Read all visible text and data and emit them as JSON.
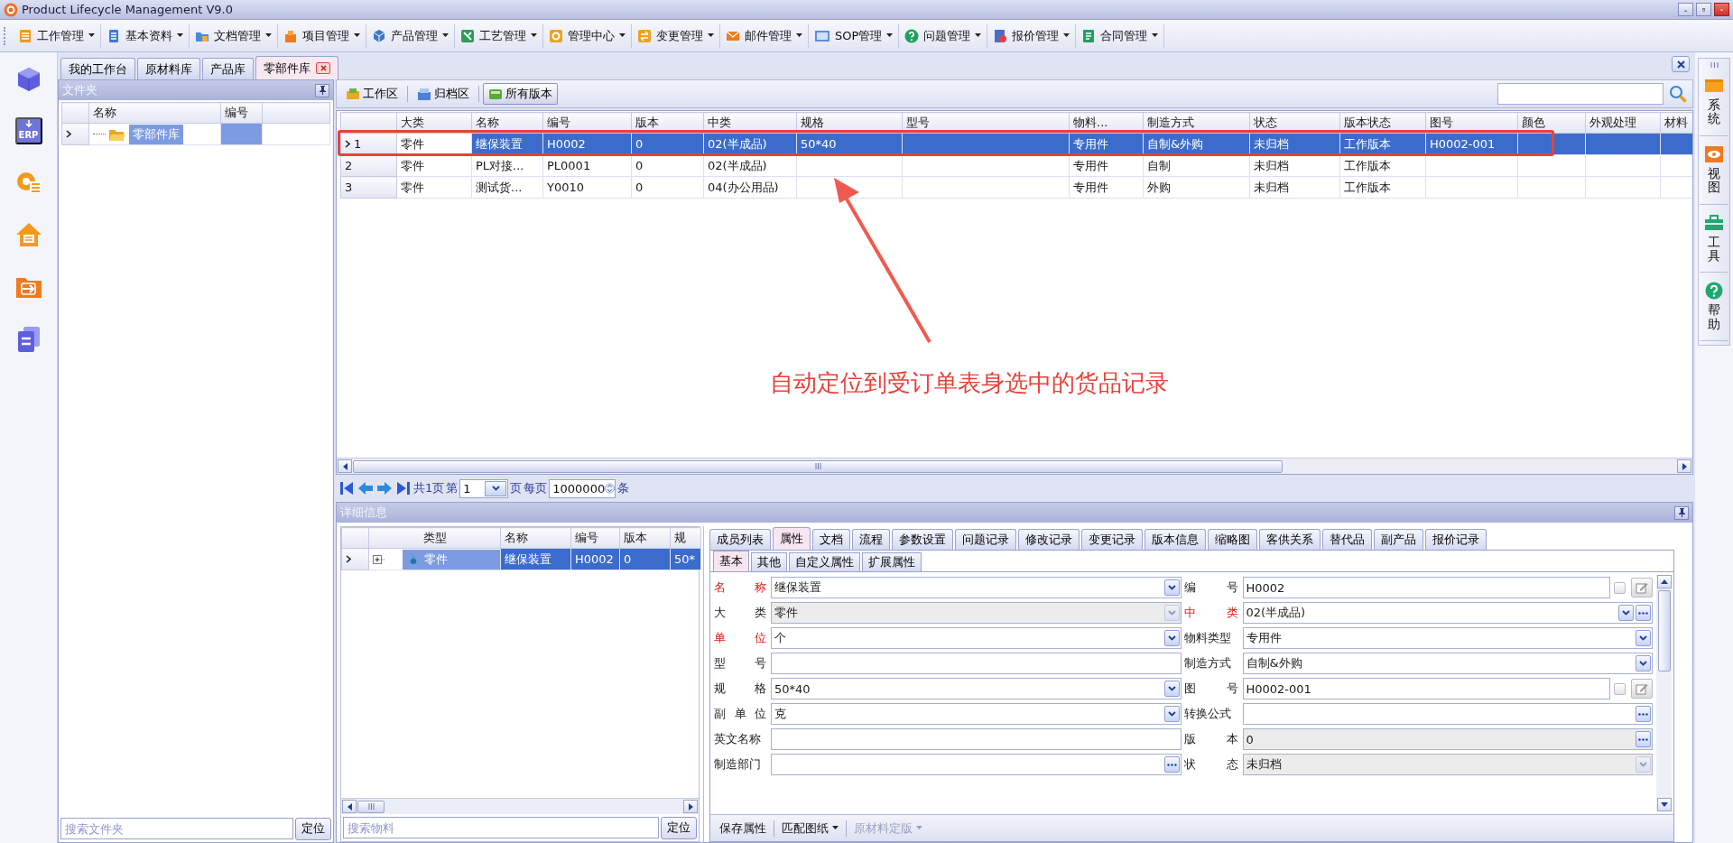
{
  "window": {
    "title": "Product Lifecycle Management V9.0"
  },
  "menu": [
    {
      "label": "工作管理"
    },
    {
      "label": "基本资料"
    },
    {
      "label": "文档管理"
    },
    {
      "label": "项目管理"
    },
    {
      "label": "产品管理"
    },
    {
      "label": "工艺管理"
    },
    {
      "label": "管理中心"
    },
    {
      "label": "变更管理"
    },
    {
      "label": "邮件管理"
    },
    {
      "label": "SOP管理"
    },
    {
      "label": "问题管理"
    },
    {
      "label": "报价管理"
    },
    {
      "label": "合同管理"
    }
  ],
  "left_rail": {
    "erp_icon_text": "ERP"
  },
  "doc_tabs": [
    {
      "label": "我的工作台",
      "selected": false,
      "closable": false
    },
    {
      "label": "原材料库",
      "selected": false,
      "closable": false
    },
    {
      "label": "产品库",
      "selected": false,
      "closable": false
    },
    {
      "label": "零部件库",
      "selected": true,
      "closable": true
    }
  ],
  "folder_panel": {
    "title": "文件夹",
    "columns": [
      "名称",
      "编号"
    ],
    "tree": [
      {
        "name": "零部件库",
        "selected": true
      }
    ],
    "search": {
      "placeholder": "搜索文件夹"
    },
    "locate_button": "定位"
  },
  "toolbar": [
    {
      "label": "工作区",
      "selected": false
    },
    {
      "label": "归档区",
      "selected": false
    },
    {
      "label": "所有版本",
      "selected": true
    }
  ],
  "table": {
    "columns": [
      "大类",
      "名称",
      "编号",
      "版本",
      "中类",
      "规格",
      "型号",
      "物料...",
      "制造方式",
      "状态",
      "版本状态",
      "图号",
      "颜色",
      "外观处理",
      "材料"
    ],
    "rows": [
      {
        "index": "1",
        "selected": true,
        "cells": [
          "零件",
          "继保装置",
          "H0002",
          "0",
          "02(半成品)",
          "50*40",
          null,
          "专用件",
          "自制&外购",
          "未归档",
          "工作版本",
          "H0002-001",
          null,
          null,
          null
        ]
      },
      {
        "index": "2",
        "selected": false,
        "cells": [
          "零件",
          "PL对接...",
          "PL0001",
          "0",
          "02(半成品)",
          null,
          null,
          "专用件",
          "自制",
          "未归档",
          "工作版本",
          null,
          null,
          null,
          null
        ]
      },
      {
        "index": "3",
        "selected": false,
        "cells": [
          "零件",
          "测试货...",
          "Y0010",
          "0",
          "04(办公用品)",
          null,
          null,
          "专用件",
          "外购",
          "未归档",
          "工作版本",
          null,
          null,
          null,
          null
        ]
      }
    ]
  },
  "annotation": {
    "text": "自动定位到受订单表身选中的货品记录"
  },
  "pager": {
    "total_pages": "共1页",
    "page_prefix": "第",
    "page": "1",
    "page_suffix": "页",
    "per_page_label": "每页",
    "per_page": "1000000",
    "unit": "条"
  },
  "detail": {
    "title": "详细信息",
    "grid": {
      "columns": [
        "类型",
        "名称",
        "编号",
        "版本",
        "规"
      ],
      "rows": [
        {
          "selected": true,
          "expanded": false,
          "cells": [
            "零件",
            "继保装置",
            "H0002",
            "0",
            "50*"
          ]
        }
      ]
    },
    "search": {
      "placeholder": "搜索物料"
    },
    "locate_button": "定位",
    "tabs": [
      {
        "label": "成员列表",
        "selected": false
      },
      {
        "label": "属性",
        "selected": true
      },
      {
        "label": "文档",
        "selected": false
      },
      {
        "label": "流程",
        "selected": false
      },
      {
        "label": "参数设置",
        "selected": false
      },
      {
        "label": "问题记录",
        "selected": false
      },
      {
        "label": "修改记录",
        "selected": false
      },
      {
        "label": "变更记录",
        "selected": false
      },
      {
        "label": "版本信息",
        "selected": false
      },
      {
        "label": "缩略图",
        "selected": false
      },
      {
        "label": "客供关系",
        "selected": false
      },
      {
        "label": "替代品",
        "selected": false
      },
      {
        "label": "副产品",
        "selected": false
      },
      {
        "label": "报价记录",
        "selected": false
      }
    ],
    "subtabs": [
      {
        "label": "基本",
        "selected": true
      },
      {
        "label": "其他",
        "selected": false
      },
      {
        "label": "自定义属性",
        "selected": false
      },
      {
        "label": "扩展属性",
        "selected": false
      }
    ],
    "fields": [
      {
        "label": "名称",
        "value": "继保装置",
        "kind": "dropdown",
        "required": true,
        "disabled": false
      },
      {
        "label": "编号",
        "value": "H0002",
        "kind": "checkedit",
        "checked": false,
        "required": false,
        "disabled": false
      },
      {
        "label": "大类",
        "value": "零件",
        "kind": "dropdown",
        "required": false,
        "disabled": true
      },
      {
        "label": "中类",
        "value": "02(半成品)",
        "kind": "dropbrowse",
        "required": true,
        "disabled": false
      },
      {
        "label": "单位",
        "value": "个",
        "kind": "dropdown",
        "required": true,
        "disabled": false
      },
      {
        "label": "物料类型",
        "value": "专用件",
        "kind": "dropdown",
        "required": false,
        "disabled": false
      },
      {
        "label": "型号",
        "kind": "text",
        "required": false,
        "disabled": false
      },
      {
        "label": "制造方式",
        "value": "自制&外购",
        "kind": "dropdown",
        "required": false,
        "disabled": false
      },
      {
        "label": "规格",
        "value": "50*40",
        "kind": "dropdown",
        "required": false,
        "disabled": false
      },
      {
        "label": "图号",
        "value": "H0002-001",
        "kind": "checkedit",
        "checked": false,
        "required": false,
        "disabled": false
      },
      {
        "label": "副单位",
        "value": "克",
        "kind": "dropdown",
        "required": false,
        "disabled": false
      },
      {
        "label": "转换公式",
        "kind": "browse",
        "required": false,
        "disabled": false
      },
      {
        "label": "英文名称",
        "kind": "text",
        "required": false,
        "disabled": false
      },
      {
        "label": "版本",
        "value": "0",
        "kind": "browse",
        "required": false,
        "disabled": true
      },
      {
        "label": "制造部门",
        "kind": "browse",
        "required": false,
        "disabled": false
      },
      {
        "label": "状态",
        "value": "未归档",
        "kind": "dropdown",
        "required": false,
        "disabled": true
      }
    ],
    "actions": [
      {
        "label": "保存属性",
        "menu": false,
        "disabled": false
      },
      {
        "label": "匹配图纸",
        "menu": true,
        "disabled": false
      },
      {
        "label": "原材料定版",
        "menu": true,
        "disabled": true
      }
    ]
  },
  "right_sidebar": [
    {
      "label": "系统"
    },
    {
      "label": "视图"
    },
    {
      "label": "工具"
    },
    {
      "label": "帮助"
    }
  ]
}
